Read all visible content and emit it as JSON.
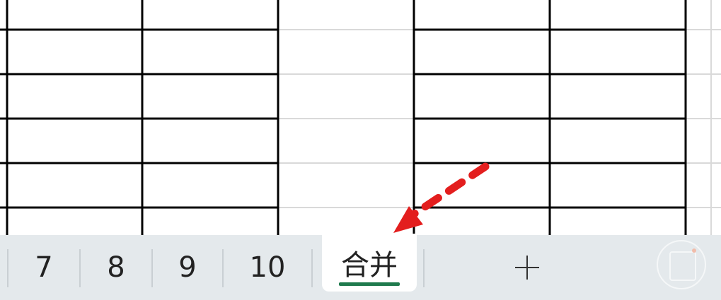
{
  "sheet_tabs": {
    "tabs": [
      {
        "label": "7"
      },
      {
        "label": "8"
      },
      {
        "label": "9"
      },
      {
        "label": "10"
      },
      {
        "label": "合并",
        "active": true
      }
    ],
    "add_button_icon": "plus-icon"
  },
  "annotation": {
    "arrow_icon": "red-dashed-arrow-icon",
    "color": "#e31e1e"
  },
  "colors": {
    "active_tab_underline": "#1f7a4d",
    "tab_bar_background": "#e4e9ec",
    "grid_border": "#000000",
    "grid_light": "#d9d9d9"
  },
  "watermark_icon": "app-logo-watermark-icon"
}
